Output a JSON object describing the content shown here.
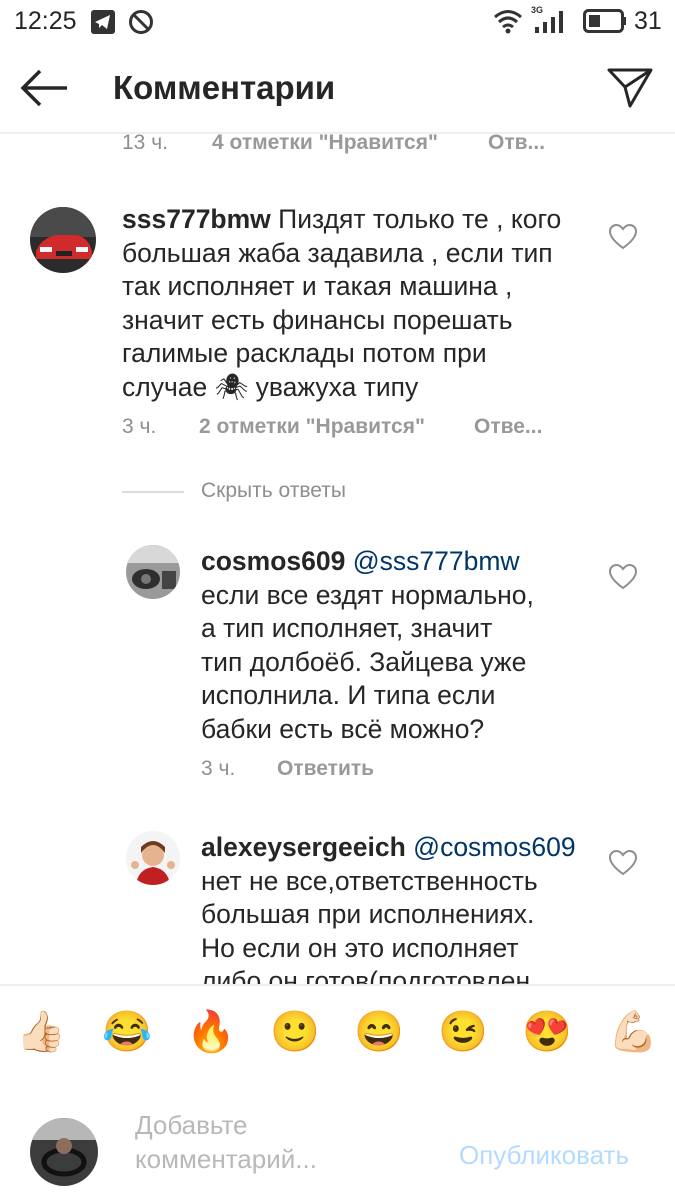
{
  "status_bar": {
    "time": "12:25",
    "signal_label": "3G",
    "battery": "31",
    "icons": [
      "telegram-icon",
      "do-not-disturb-icon",
      "wifi-icon",
      "signal-icon",
      "battery-icon"
    ]
  },
  "header": {
    "title": "Комментарии",
    "back_icon": "arrow-left-icon",
    "share_icon": "paper-plane-icon"
  },
  "top_partial": {
    "time": "13 ч.",
    "likes": "4 отметки \"Нравится\"",
    "reply": "Отв..."
  },
  "comments": [
    {
      "username": "sss777bmw",
      "lines": [
        "Пиздят только те , кого",
        "большая жаба задавила , если тип",
        "так исполняет и такая машина ,",
        "значит есть финансы порешать",
        "галимые расклады потом при",
        "случае 🕷 уважуха типу"
      ],
      "time": "3 ч.",
      "likes": "2 отметки \"Нравится\"",
      "reply": "Отве..."
    }
  ],
  "hide_replies": "Скрыть ответы",
  "replies": [
    {
      "username": "cosmos609",
      "mention": "@sss777bmw",
      "lines": [
        "если все ездят нормально,",
        "а тип исполняет, значит",
        "тип долбоёб. Зайцева уже",
        "исполнила. И типа если",
        "бабки есть всё можно?"
      ],
      "time": "3 ч.",
      "reply": "Ответить"
    },
    {
      "username": "alexeysergeeich",
      "mention": "@cosmos609",
      "lines": [
        "нет не все,ответственность",
        "большая при исполнениях.",
        "Но если он это исполняет",
        "либо он готов(подготовлен"
      ]
    }
  ],
  "emoji_bar": [
    "👍🏻",
    "😂",
    "🔥",
    "🙂",
    "😄",
    "😉",
    "😍",
    "💪🏻"
  ],
  "composer": {
    "placeholder": "Добавьте комментарий...",
    "publish": "Опубликовать"
  },
  "colors": {
    "text": "#262626",
    "meta": "#8e8e8e",
    "mention": "#003569",
    "publish_disabled": "#b3dbff",
    "divider": "#efefef"
  }
}
